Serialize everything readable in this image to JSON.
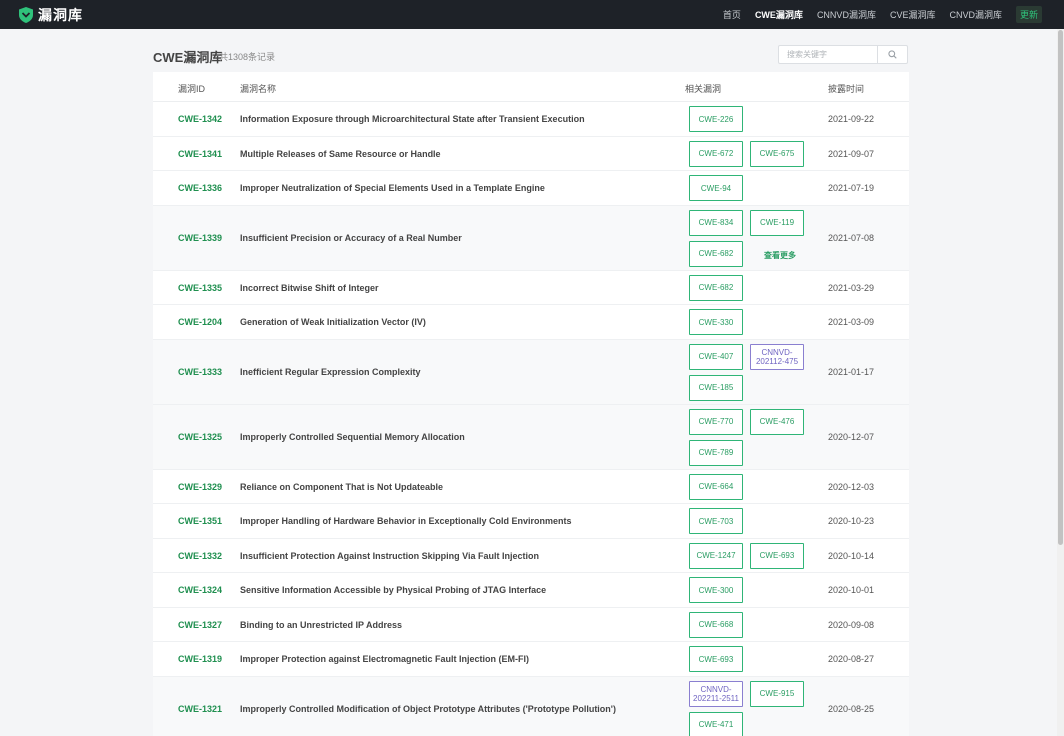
{
  "nav": {
    "brand": "漏洞库",
    "items": [
      "首页",
      "CWE漏洞库",
      "CNNVD漏洞库",
      "CVE漏洞库",
      "CNVD漏洞库"
    ],
    "active_index": 1,
    "update_label": "更新"
  },
  "page": {
    "title": "CWE漏洞库",
    "count": "共1308条记录"
  },
  "search": {
    "placeholder": "搜索关键字",
    "value": ""
  },
  "table": {
    "headers": {
      "id": "漏洞ID",
      "name": "漏洞名称",
      "related": "相关漏洞",
      "date": "披露时间"
    },
    "more_label": "查看更多",
    "rows": [
      {
        "id": "CWE-1342",
        "name": "Information Exposure through Microarchitectural State after Transient Execution",
        "tags": [
          "CWE-226"
        ],
        "date": "2021-09-22"
      },
      {
        "id": "CWE-1341",
        "name": "Multiple Releases of Same Resource or Handle",
        "tags": [
          "CWE-672",
          "CWE-675"
        ],
        "date": "2021-09-07"
      },
      {
        "id": "CWE-1336",
        "name": "Improper Neutralization of Special Elements Used in a Template Engine",
        "tags": [
          "CWE-94"
        ],
        "date": "2021-07-19"
      },
      {
        "id": "CWE-1339",
        "name": "Insufficient Precision or Accuracy of a Real Number",
        "tags": [
          "CWE-834",
          "CWE-119",
          "CWE-682"
        ],
        "more": true,
        "date": "2021-07-08"
      },
      {
        "id": "CWE-1335",
        "name": "Incorrect Bitwise Shift of Integer",
        "tags": [
          "CWE-682"
        ],
        "date": "2021-03-29"
      },
      {
        "id": "CWE-1204",
        "name": "Generation of Weak Initialization Vector (IV)",
        "tags": [
          "CWE-330"
        ],
        "date": "2021-03-09"
      },
      {
        "id": "CWE-1333",
        "name": "Inefficient Regular Expression Complexity",
        "tags": [
          "CWE-407",
          "CNNVD-202112-475",
          "CWE-185"
        ],
        "date": "2021-01-17"
      },
      {
        "id": "CWE-1325",
        "name": "Improperly Controlled Sequential Memory Allocation",
        "tags": [
          "CWE-770",
          "CWE-476",
          "CWE-789"
        ],
        "date": "2020-12-07"
      },
      {
        "id": "CWE-1329",
        "name": "Reliance on Component That is Not Updateable",
        "tags": [
          "CWE-664"
        ],
        "date": "2020-12-03"
      },
      {
        "id": "CWE-1351",
        "name": "Improper Handling of Hardware Behavior in Exceptionally Cold Environments",
        "tags": [
          "CWE-703"
        ],
        "date": "2020-10-23"
      },
      {
        "id": "CWE-1332",
        "name": "Insufficient Protection Against Instruction Skipping Via Fault Injection",
        "tags": [
          "CWE-1247",
          "CWE-693"
        ],
        "date": "2020-10-14"
      },
      {
        "id": "CWE-1324",
        "name": "Sensitive Information Accessible by Physical Probing of JTAG Interface",
        "tags": [
          "CWE-300"
        ],
        "date": "2020-10-01"
      },
      {
        "id": "CWE-1327",
        "name": "Binding to an Unrestricted IP Address",
        "tags": [
          "CWE-668"
        ],
        "date": "2020-09-08"
      },
      {
        "id": "CWE-1319",
        "name": "Improper Protection against Electromagnetic Fault Injection (EM-FI)",
        "tags": [
          "CWE-693"
        ],
        "date": "2020-08-27"
      },
      {
        "id": "CWE-1321",
        "name": "Improperly Controlled Modification of Object Prototype Attributes ('Prototype Pollution')",
        "tags": [
          "CNNVD-202211-2511",
          "CWE-915",
          "CWE-471"
        ],
        "date": "2020-08-25"
      }
    ]
  },
  "colors": {
    "accent": "#2a9d63",
    "topbar": "#1e2228",
    "cnnvd_tag": "#6f63c2"
  }
}
